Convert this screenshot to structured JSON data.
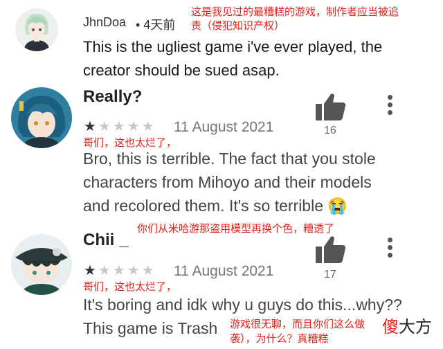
{
  "reviews": [
    {
      "username": "JhnDoa",
      "meta": "• 4天前",
      "text_line1": "This is the ugliest game i've ever played, the",
      "text_line2": "creator should be sued asap.",
      "annotation_line1": "这是我见过的最糟糕的游戏，制作者应当被追",
      "annotation_line2": "责（侵犯知识产权）"
    },
    {
      "name": "Really?",
      "rating": 1,
      "max_rating": 5,
      "date": "11 August 2021",
      "likes": "16",
      "annotation_top": "哥们，这也太烂了，",
      "text_line1": "Bro, this is terrible. The fact that you stole",
      "text_line2": "characters from Mihoyo and their models",
      "text_line3": "and recolored them. It's so terrible",
      "emoji": "😭",
      "annotation_bottom": "你们从米哈游那盗用模型再换个色，糟透了"
    },
    {
      "name": "Chii _",
      "rating": 1,
      "max_rating": 5,
      "date": "11 August 2021",
      "likes": "17",
      "annotation_top": "哥们，这也太烂了，",
      "text_line1": "It's boring and idk why u guys do this...why??",
      "text_line2": "This game is Trash",
      "annotation_line1": "游戏很无聊，而且你们这么做",
      "annotation_line2": "袭），为什么？真糟糕"
    }
  ],
  "watermark": {
    "char1": "傻",
    "char2": "大方"
  },
  "colors": {
    "annotation": "#e0201b",
    "star_filled": "#333333",
    "star_empty": "#c8c8c8"
  },
  "icons": [
    "thumbs-up-icon",
    "more-vert-icon",
    "star-icon",
    "avatar"
  ]
}
